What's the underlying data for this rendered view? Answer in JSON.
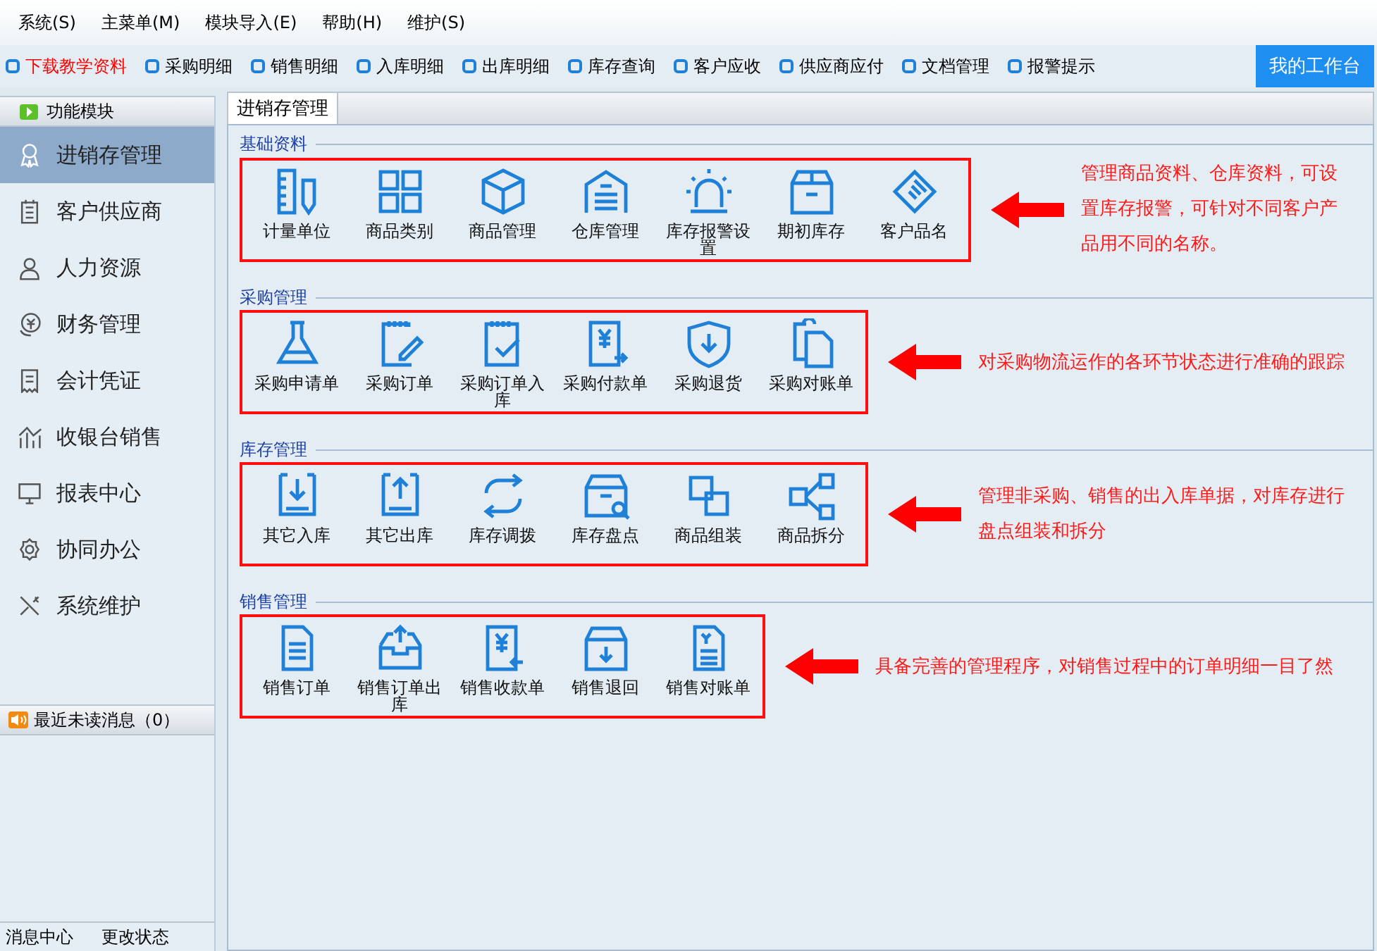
{
  "menu": [
    "系统(S)",
    "主菜单(M)",
    "模块导入(E)",
    "帮助(H)",
    "维护(S)"
  ],
  "toolbar": {
    "links": [
      {
        "label": "下载教学资料",
        "color": "#ff0000"
      },
      {
        "label": "采购明细",
        "color": "#000000"
      },
      {
        "label": "销售明细",
        "color": "#000000"
      },
      {
        "label": "入库明细",
        "color": "#000000"
      },
      {
        "label": "出库明细",
        "color": "#000000"
      },
      {
        "label": "库存查询",
        "color": "#000000"
      },
      {
        "label": "客户应收",
        "color": "#000000"
      },
      {
        "label": "供应商应付",
        "color": "#000000"
      },
      {
        "label": "文档管理",
        "color": "#000000"
      },
      {
        "label": "报警提示",
        "color": "#000000"
      }
    ],
    "workbench_button": "我的工作台"
  },
  "sidebar": {
    "header": "功能模块",
    "items": [
      {
        "label": "进销存管理",
        "selected": true
      },
      {
        "label": "客户供应商",
        "selected": false
      },
      {
        "label": "人力资源",
        "selected": false
      },
      {
        "label": "财务管理",
        "selected": false
      },
      {
        "label": "会计凭证",
        "selected": false
      },
      {
        "label": "收银台销售",
        "selected": false
      },
      {
        "label": "报表中心",
        "selected": false
      },
      {
        "label": "协同办公",
        "selected": false
      },
      {
        "label": "系统维护",
        "selected": false
      }
    ],
    "messages_header": "最近未读消息（0）",
    "footer": [
      "消息中心",
      "更改状态"
    ]
  },
  "tabs": [
    {
      "label": "进销存管理",
      "selected": true
    }
  ],
  "sections": [
    {
      "title": "基础资料",
      "items": [
        "计量单位",
        "商品类别",
        "商品管理",
        "仓库管理",
        "库存报警设置",
        "期初库存",
        "客户品名"
      ],
      "note": "管理商品资料、仓库资料，可设置库存报警，可针对不同客户产品用不同的名称。"
    },
    {
      "title": "采购管理",
      "items": [
        "采购申请单",
        "采购订单",
        "采购订单入库",
        "采购付款单",
        "采购退货",
        "采购对账单"
      ],
      "note": "对采购物流运作的各环节状态进行准确的跟踪"
    },
    {
      "title": "库存管理",
      "items": [
        "其它入库",
        "其它出库",
        "库存调拨",
        "库存盘点",
        "商品组装",
        "商品拆分"
      ],
      "note": "管理非采购、销售的出入库单据，对库存进行盘点组装和拆分"
    },
    {
      "title": "销售管理",
      "items": [
        "销售订单",
        "销售订单出库",
        "销售收款单",
        "销售退回",
        "销售对账单"
      ],
      "note": "具备完善的管理程序，对销售过程中的订单明细一目了然"
    }
  ]
}
